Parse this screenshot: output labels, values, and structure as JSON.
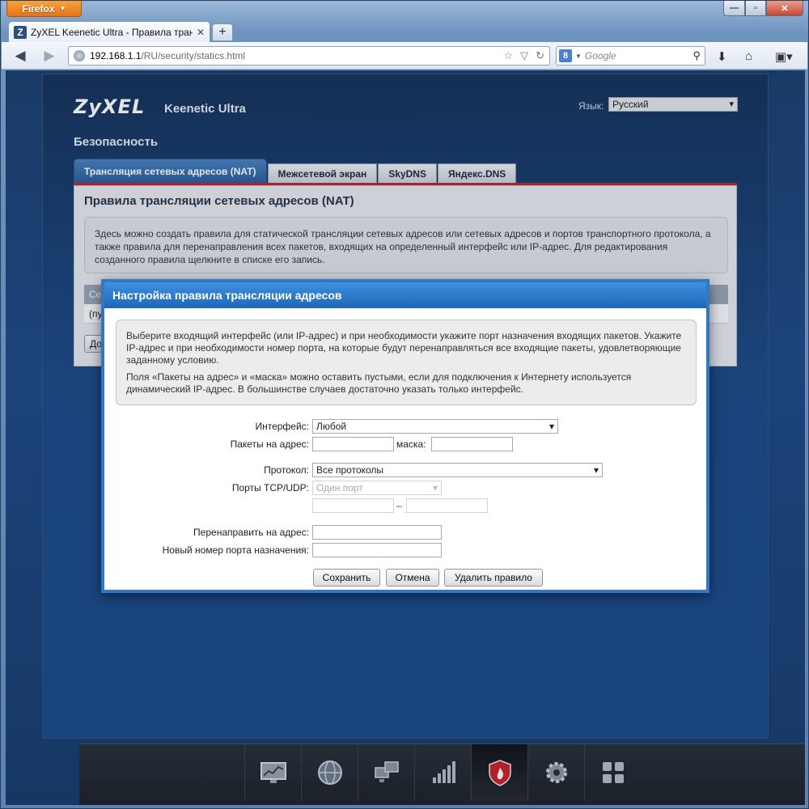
{
  "browser": {
    "menu_button": "Firefox",
    "tab_title": "ZyXEL Keenetic Ultra - Правила трансля...",
    "tab_favicon": "Z",
    "url_host": "192.168.1.1",
    "url_path": "/RU/security/statics.html",
    "search_placeholder": "Google",
    "search_engine_icon": "8"
  },
  "router": {
    "brand": "ZyXEL",
    "model": "Keenetic Ultra",
    "language_label": "Язык:",
    "language_value": "Русский",
    "section_title": "Безопасность",
    "tabs": [
      {
        "label": "Трансляция сетевых адресов (NAT)",
        "active": true
      },
      {
        "label": "Межсетевой экран",
        "active": false
      },
      {
        "label": "SkyDNS",
        "active": false
      },
      {
        "label": "Яндекс.DNS",
        "active": false
      }
    ],
    "content_title": "Правила трансляции сетевых адресов (NAT)",
    "content_info": "Здесь можно создать правила для статической трансляции сетевых адресов или сетевых адресов и портов транспортного протокола, а также правила для перенаправления всех пакетов, входящих на определенный интерфейс или IP-адрес. Для редактирования созданного правила щелкните в списке его запись.",
    "table_header_partial": "Се",
    "table_row_partial": "(пу",
    "add_button_partial": "До"
  },
  "dock": {
    "items": [
      {
        "icon": "monitor-chart-icon",
        "active": false
      },
      {
        "icon": "globe-icon",
        "active": false
      },
      {
        "icon": "network-computers-icon",
        "active": false
      },
      {
        "icon": "signal-bars-icon",
        "active": false
      },
      {
        "icon": "security-shield-icon",
        "active": true
      },
      {
        "icon": "gear-icon",
        "active": false
      },
      {
        "icon": "apps-grid-icon",
        "active": false
      }
    ]
  },
  "modal": {
    "title": "Настройка правила трансляции адресов",
    "info_p1": "Выберите входящий интерфейс (или IP-адрес) и при необходимости укажите порт назначения входящих пакетов. Укажите IP-адрес и при необходимости номер порта, на которые будут перенаправляться все входящие пакеты, удовлетворяющие заданному условию.",
    "info_p2": "Поля «Пакеты на адрес» и «маска» можно оставить пустыми, если для подключения к Интернету используется динамический IP-адрес. В большинстве случаев достаточно указать только интерфейс.",
    "fields": {
      "interface_label": "Интерфейс:",
      "interface_value": "Любой",
      "packets_label": "Пакеты на адрес:",
      "packets_value": "",
      "mask_label": "маска:",
      "mask_value": "",
      "protocol_label": "Протокол:",
      "protocol_value": "Все протоколы",
      "ports_label": "Порты TCP/UDP:",
      "ports_value": "Один порт",
      "port_from": "",
      "port_dash": "–",
      "port_to": "",
      "redirect_label": "Перенаправить на адрес:",
      "redirect_value": "",
      "new_port_label": "Новый номер порта назначения:",
      "new_port_value": ""
    },
    "buttons": {
      "save": "Сохранить",
      "cancel": "Отмена",
      "delete": "Удалить правило"
    }
  },
  "colors": {
    "modal_border": "#2f78c8",
    "active_tab": "#2d5f9a",
    "tab_underline": "#c8232a",
    "firefox_orange": "#e4731a"
  }
}
